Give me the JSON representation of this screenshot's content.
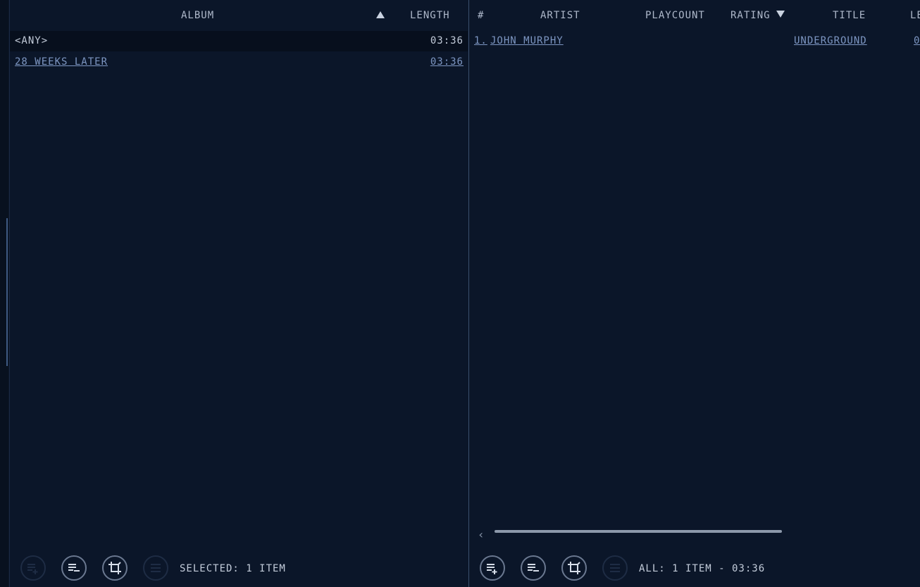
{
  "left_pane": {
    "columns": {
      "album": "ALBUM",
      "length": "LENGTH"
    },
    "sort": "ascending",
    "rows": [
      {
        "album": "<ANY>",
        "length": "03:36"
      },
      {
        "album": "28 WEEKS LATER",
        "length": "03:36"
      }
    ],
    "footer": {
      "buttons": [
        "add-to-playlist-icon",
        "remove-from-playlist-icon",
        "crop-icon",
        "menu-list-icon"
      ],
      "status": "SELECTED:  1 ITEM"
    }
  },
  "right_pane": {
    "columns": {
      "number": "#",
      "artist": "ARTIST",
      "playcount": "PLAYCOUNT",
      "rating": "RATING",
      "title": "TITLE",
      "length": "LE"
    },
    "sort": "descending",
    "rows": [
      {
        "number": "1.",
        "artist": "JOHN MURPHY",
        "title": "UNDERGROUND",
        "length": "0"
      }
    ],
    "footer": {
      "buttons": [
        "add-to-playlist-icon",
        "remove-from-playlist-icon",
        "crop-icon",
        "menu-list-icon"
      ],
      "status": "ALL:  1 ITEM - 03:36"
    }
  },
  "colors": {
    "background": "#0b1629",
    "link": "#7d96c2",
    "text": "#c3ccda"
  }
}
